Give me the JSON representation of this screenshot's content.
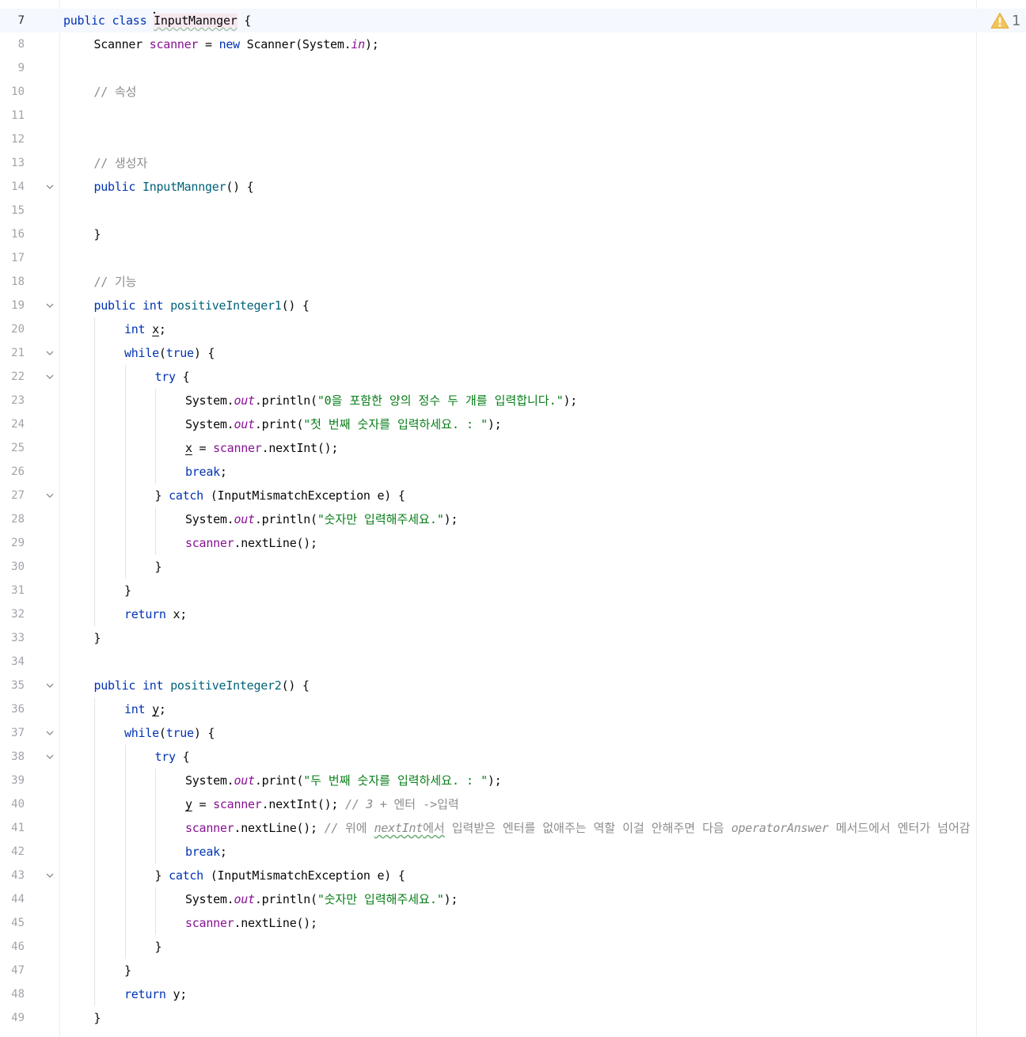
{
  "editor": {
    "inspection": {
      "icon": "warning-triangle-icon",
      "count": "1",
      "color": "#f2c55c"
    },
    "current_line": 7,
    "lines": [
      {
        "n": "7",
        "indent": 0,
        "fold": false,
        "tokens": [
          [
            "kw",
            "public"
          ],
          [
            "",
            " "
          ],
          [
            "kw",
            "class"
          ],
          [
            "",
            " "
          ],
          [
            "caret",
            ""
          ],
          [
            "cls-ul",
            "InputMannger"
          ],
          [
            "",
            " {"
          ]
        ]
      },
      {
        "n": "8",
        "indent": 1,
        "fold": false,
        "tokens": [
          [
            "",
            "Scanner "
          ],
          [
            "fld",
            "scanner"
          ],
          [
            "",
            " = "
          ],
          [
            "kw",
            "new"
          ],
          [
            "",
            " Scanner(System."
          ],
          [
            "sfld",
            "in"
          ],
          [
            "",
            ");"
          ]
        ]
      },
      {
        "n": "9",
        "indent": 0,
        "fold": false,
        "tokens": []
      },
      {
        "n": "10",
        "indent": 1,
        "fold": false,
        "tokens": [
          [
            "cmt",
            "// "
          ],
          [
            "cmt ko",
            "속성"
          ]
        ]
      },
      {
        "n": "11",
        "indent": 0,
        "fold": false,
        "tokens": []
      },
      {
        "n": "12",
        "indent": 0,
        "fold": false,
        "tokens": []
      },
      {
        "n": "13",
        "indent": 1,
        "fold": false,
        "tokens": [
          [
            "cmt",
            "// "
          ],
          [
            "cmt ko",
            "생성자"
          ]
        ]
      },
      {
        "n": "14",
        "indent": 1,
        "fold": true,
        "tokens": [
          [
            "kw",
            "public"
          ],
          [
            "",
            " "
          ],
          [
            "fn",
            "InputMannger"
          ],
          [
            "",
            "() {"
          ]
        ]
      },
      {
        "n": "15",
        "indent": 0,
        "fold": false,
        "tokens": []
      },
      {
        "n": "16",
        "indent": 1,
        "fold": false,
        "tokens": [
          [
            "",
            "}"
          ]
        ]
      },
      {
        "n": "17",
        "indent": 0,
        "fold": false,
        "tokens": []
      },
      {
        "n": "18",
        "indent": 1,
        "fold": false,
        "tokens": [
          [
            "cmt",
            "// "
          ],
          [
            "cmt ko",
            "기능"
          ]
        ]
      },
      {
        "n": "19",
        "indent": 1,
        "fold": true,
        "tokens": [
          [
            "kw",
            "public"
          ],
          [
            "",
            " "
          ],
          [
            "kw",
            "int"
          ],
          [
            "",
            " "
          ],
          [
            "fn",
            "positiveInteger1"
          ],
          [
            "",
            "() {"
          ]
        ]
      },
      {
        "n": "20",
        "indent": 2,
        "fold": false,
        "tokens": [
          [
            "kw",
            "int"
          ],
          [
            "",
            " "
          ],
          [
            "var-ul",
            "x"
          ],
          [
            "",
            ";"
          ]
        ]
      },
      {
        "n": "21",
        "indent": 2,
        "fold": true,
        "tokens": [
          [
            "kw",
            "while"
          ],
          [
            "",
            "("
          ],
          [
            "kw",
            "true"
          ],
          [
            "",
            ") {"
          ]
        ]
      },
      {
        "n": "22",
        "indent": 3,
        "fold": true,
        "tokens": [
          [
            "kw",
            "try"
          ],
          [
            "",
            " {"
          ]
        ]
      },
      {
        "n": "23",
        "indent": 4,
        "fold": false,
        "tokens": [
          [
            "",
            "System."
          ],
          [
            "sfld",
            "out"
          ],
          [
            "",
            ".println("
          ],
          [
            "str",
            "\""
          ],
          [
            "str ko",
            "0을 포함한 양의 정수 두 개를 입력합니다."
          ],
          [
            "str",
            "\""
          ],
          [
            "",
            ");"
          ]
        ]
      },
      {
        "n": "24",
        "indent": 4,
        "fold": false,
        "tokens": [
          [
            "",
            "System."
          ],
          [
            "sfld",
            "out"
          ],
          [
            "",
            ".print("
          ],
          [
            "str",
            "\""
          ],
          [
            "str ko",
            "첫 번째 숫자를 입력하세요. : "
          ],
          [
            "str",
            "\""
          ],
          [
            "",
            ");"
          ]
        ]
      },
      {
        "n": "25",
        "indent": 4,
        "fold": false,
        "tokens": [
          [
            "var-ul",
            "x"
          ],
          [
            "",
            " = "
          ],
          [
            "fld",
            "scanner"
          ],
          [
            "",
            ".nextInt();"
          ]
        ]
      },
      {
        "n": "26",
        "indent": 4,
        "fold": false,
        "tokens": [
          [
            "kw",
            "break"
          ],
          [
            "",
            ";"
          ]
        ]
      },
      {
        "n": "27",
        "indent": 3,
        "fold": true,
        "tokens": [
          [
            "",
            "} "
          ],
          [
            "kw",
            "catch"
          ],
          [
            "",
            " (InputMismatchException e) {"
          ]
        ]
      },
      {
        "n": "28",
        "indent": 4,
        "fold": false,
        "tokens": [
          [
            "",
            "System."
          ],
          [
            "sfld",
            "out"
          ],
          [
            "",
            ".println("
          ],
          [
            "str",
            "\""
          ],
          [
            "str ko",
            "숫자만 입력해주세요."
          ],
          [
            "str",
            "\""
          ],
          [
            "",
            ");"
          ]
        ]
      },
      {
        "n": "29",
        "indent": 4,
        "fold": false,
        "tokens": [
          [
            "fld",
            "scanner"
          ],
          [
            "",
            ".nextLine();"
          ]
        ]
      },
      {
        "n": "30",
        "indent": 3,
        "fold": false,
        "tokens": [
          [
            "",
            "}"
          ]
        ]
      },
      {
        "n": "31",
        "indent": 2,
        "fold": false,
        "tokens": [
          [
            "",
            "}"
          ]
        ]
      },
      {
        "n": "32",
        "indent": 2,
        "fold": false,
        "tokens": [
          [
            "kw",
            "return"
          ],
          [
            "",
            " x;"
          ]
        ]
      },
      {
        "n": "33",
        "indent": 1,
        "fold": false,
        "tokens": [
          [
            "",
            "}"
          ]
        ]
      },
      {
        "n": "34",
        "indent": 0,
        "fold": false,
        "tokens": []
      },
      {
        "n": "35",
        "indent": 1,
        "fold": true,
        "tokens": [
          [
            "kw",
            "public"
          ],
          [
            "",
            " "
          ],
          [
            "kw",
            "int"
          ],
          [
            "",
            " "
          ],
          [
            "fn",
            "positiveInteger2"
          ],
          [
            "",
            "() {"
          ]
        ]
      },
      {
        "n": "36",
        "indent": 2,
        "fold": false,
        "tokens": [
          [
            "kw",
            "int"
          ],
          [
            "",
            " "
          ],
          [
            "var-ul",
            "y"
          ],
          [
            "",
            ";"
          ]
        ]
      },
      {
        "n": "37",
        "indent": 2,
        "fold": true,
        "tokens": [
          [
            "kw",
            "while"
          ],
          [
            "",
            "("
          ],
          [
            "kw",
            "true"
          ],
          [
            "",
            ") {"
          ]
        ]
      },
      {
        "n": "38",
        "indent": 3,
        "fold": true,
        "tokens": [
          [
            "kw",
            "try"
          ],
          [
            "",
            " {"
          ]
        ]
      },
      {
        "n": "39",
        "indent": 4,
        "fold": false,
        "tokens": [
          [
            "",
            "System."
          ],
          [
            "sfld",
            "out"
          ],
          [
            "",
            ".print("
          ],
          [
            "str",
            "\""
          ],
          [
            "str ko",
            "두 번째 숫자를 입력하세요. : "
          ],
          [
            "str",
            "\""
          ],
          [
            "",
            ");"
          ]
        ]
      },
      {
        "n": "40",
        "indent": 4,
        "fold": false,
        "tokens": [
          [
            "var-ul",
            "y"
          ],
          [
            "",
            " = "
          ],
          [
            "fld",
            "scanner"
          ],
          [
            "",
            ".nextInt(); "
          ],
          [
            "cmti",
            "// 3 + "
          ],
          [
            "cmt ko",
            "엔터 ->입력"
          ]
        ]
      },
      {
        "n": "41",
        "indent": 4,
        "fold": false,
        "tokens": [
          [
            "fld",
            "scanner"
          ],
          [
            "",
            ".nextLine(); "
          ],
          [
            "cmti",
            "// "
          ],
          [
            "cmt ko",
            "위에 "
          ],
          [
            "cmti warn-ul",
            "nextInt"
          ],
          [
            "cmt ko warn-ul",
            "에서"
          ],
          [
            "cmt ko",
            " 입력받은 엔터를 없애주는 역할 이걸 안해주면 다음 "
          ],
          [
            "cmti",
            "operatorAnswer"
          ],
          [
            "cmt ko",
            " 메서드에서 엔터가 넘어감"
          ]
        ]
      },
      {
        "n": "42",
        "indent": 4,
        "fold": false,
        "tokens": [
          [
            "kw",
            "break"
          ],
          [
            "",
            ";"
          ]
        ]
      },
      {
        "n": "43",
        "indent": 3,
        "fold": true,
        "tokens": [
          [
            "",
            "} "
          ],
          [
            "kw",
            "catch"
          ],
          [
            "",
            " (InputMismatchException e) {"
          ]
        ]
      },
      {
        "n": "44",
        "indent": 4,
        "fold": false,
        "tokens": [
          [
            "",
            "System."
          ],
          [
            "sfld",
            "out"
          ],
          [
            "",
            ".println("
          ],
          [
            "str",
            "\""
          ],
          [
            "str ko",
            "숫자만 입력해주세요."
          ],
          [
            "str",
            "\""
          ],
          [
            "",
            ");"
          ]
        ]
      },
      {
        "n": "45",
        "indent": 4,
        "fold": false,
        "tokens": [
          [
            "fld",
            "scanner"
          ],
          [
            "",
            ".nextLine();"
          ]
        ]
      },
      {
        "n": "46",
        "indent": 3,
        "fold": false,
        "tokens": [
          [
            "",
            "}"
          ]
        ]
      },
      {
        "n": "47",
        "indent": 2,
        "fold": false,
        "tokens": [
          [
            "",
            "}"
          ]
        ]
      },
      {
        "n": "48",
        "indent": 2,
        "fold": false,
        "tokens": [
          [
            "kw",
            "return"
          ],
          [
            "",
            " y;"
          ]
        ]
      },
      {
        "n": "49",
        "indent": 1,
        "fold": false,
        "tokens": [
          [
            "",
            "}"
          ]
        ]
      }
    ]
  }
}
